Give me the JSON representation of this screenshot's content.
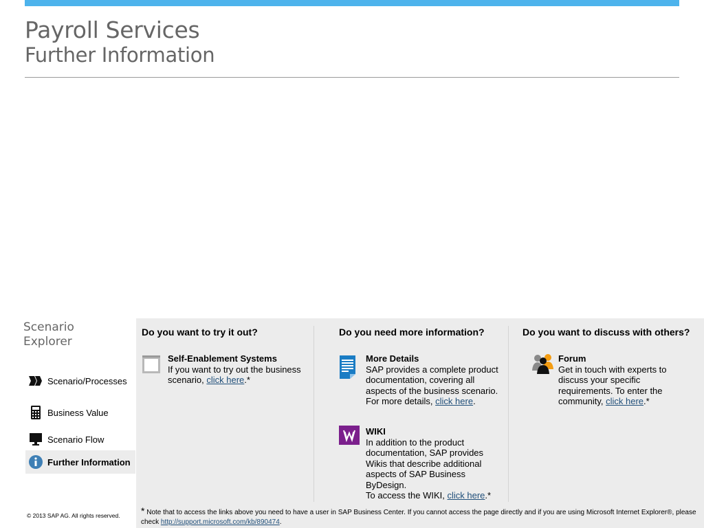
{
  "header": {
    "title": "Payroll Services",
    "subtitle": "Further Information"
  },
  "sidebar": {
    "title": "Scenario Explorer",
    "items": [
      {
        "label": "Scenario/Processes",
        "icon": "double-chevron-icon"
      },
      {
        "label": "Business Value",
        "icon": "calculator-icon"
      },
      {
        "label": "Scenario Flow",
        "icon": "monitor-icon"
      },
      {
        "label": "Further Information",
        "icon": "info-icon",
        "active": true
      }
    ]
  },
  "columns": [
    {
      "heading": "Do you want to try it out?",
      "items": [
        {
          "title": "Self-Enablement Systems",
          "text": "If you want to try out the  business scenario, ",
          "link": "click here",
          "suffix": ".*",
          "icon": "window-icon"
        }
      ]
    },
    {
      "heading": "Do you need more information?",
      "items": [
        {
          "title": "More Details",
          "text": "SAP provides a complete product documentation, covering all aspects of the business scenario. For more details, ",
          "link": "click here",
          "suffix": ".",
          "icon": "document-icon"
        },
        {
          "title": "WIKI",
          "text": "In addition to the product documentation, SAP provides Wikis that describe additional aspects of SAP Business ByDesign.",
          "text2": "To access the WIKI, ",
          "link": "click here",
          "suffix": ".*",
          "icon": "wiki-icon"
        }
      ]
    },
    {
      "heading": "Do you want to discuss with others?",
      "items": [
        {
          "title": "Forum",
          "text": "Get in touch with experts to discuss your specific requirements. To enter the community, ",
          "link": "click here",
          "suffix": ".*",
          "icon": "people-icon"
        }
      ]
    }
  ],
  "footnote": {
    "star": "*",
    "text": " Note that to access the links above you need to have a user in SAP Business Center. If you cannot access the page directly and if you are using Microsoft Internet Explorer®, please check ",
    "link": "http://support.microsoft.com/kb/890474",
    "suffix": "."
  },
  "copyright": "©  2013 SAP AG. All rights reserved.",
  "colors": {
    "accent": "#4db3ec",
    "title_gray": "#666666",
    "panel_bg": "#ececec",
    "link": "#1f4e79",
    "doc_blue": "#1a7cc4",
    "wiki_purple": "#7b1f8c",
    "info_blue": "#3e7fb5"
  }
}
